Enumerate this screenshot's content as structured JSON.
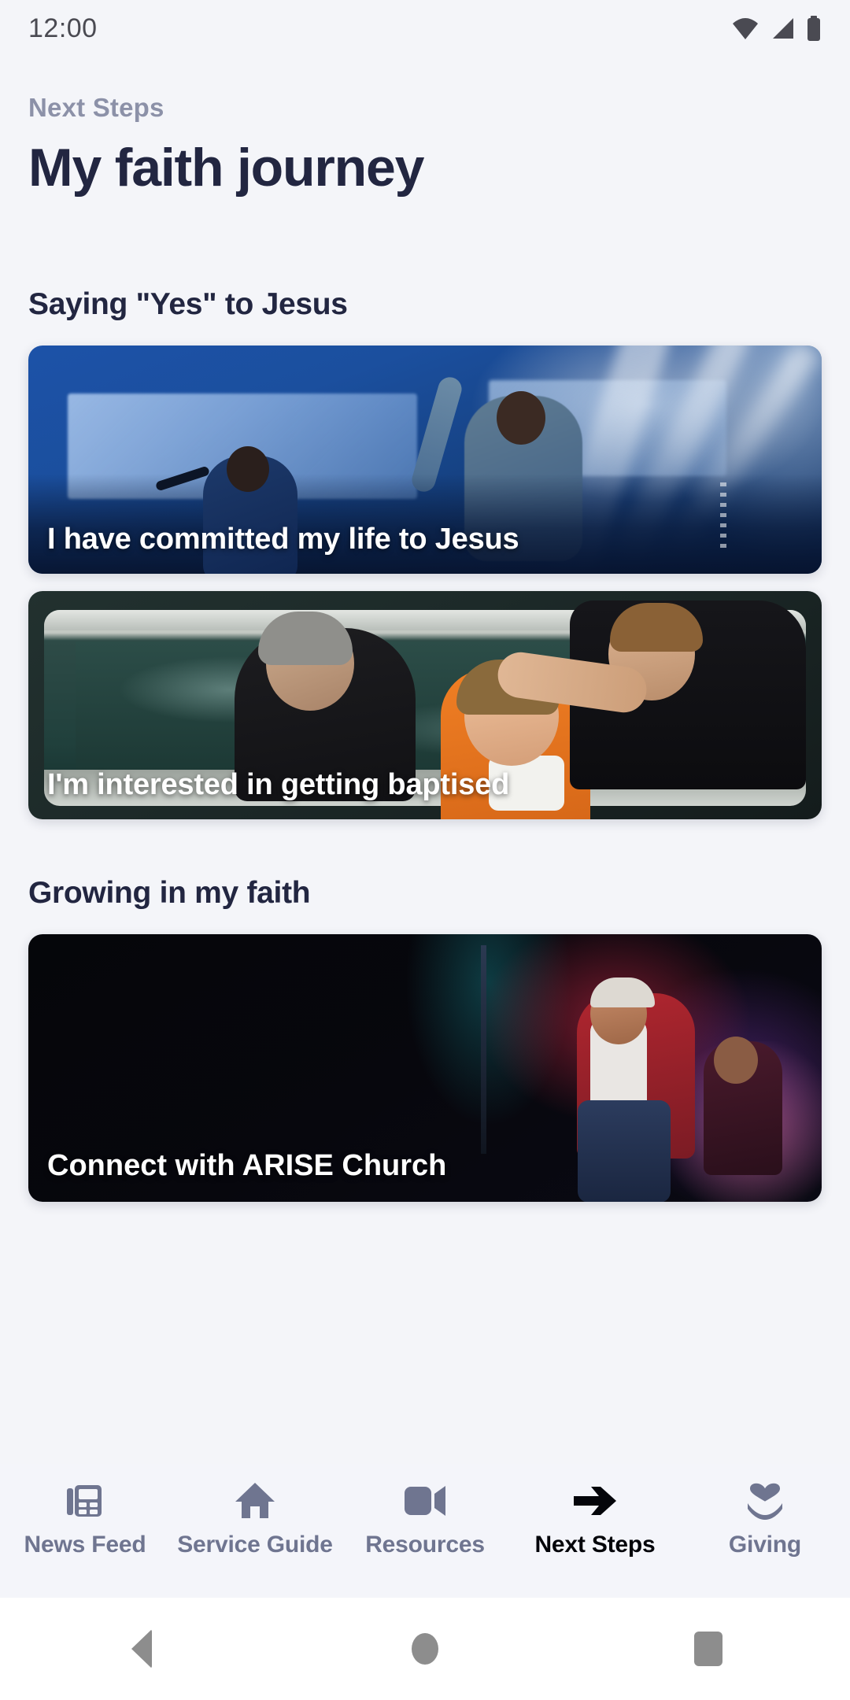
{
  "status_bar": {
    "time": "12:00",
    "icons": [
      "wifi-icon",
      "cellular-signal-icon",
      "battery-icon"
    ]
  },
  "header": {
    "eyebrow": "Next Steps",
    "title": "My faith journey"
  },
  "sections": [
    {
      "heading": "Saying \"Yes\" to Jesus",
      "cards": [
        {
          "caption": "I have committed my life to Jesus",
          "art": "worship-stage-photo"
        },
        {
          "caption": "I'm interested in getting baptised",
          "art": "baptism-photo"
        }
      ]
    },
    {
      "heading": "Growing in my faith",
      "cards": [
        {
          "caption": "Connect with ARISE Church",
          "art": "concert-stage-photo"
        }
      ]
    }
  ],
  "tab_bar": {
    "items": [
      {
        "label": "News Feed",
        "icon": "newspaper-icon",
        "active": false
      },
      {
        "label": "Service Guide",
        "icon": "home-icon",
        "active": false
      },
      {
        "label": "Resources",
        "icon": "video-camera-icon",
        "active": false
      },
      {
        "label": "Next Steps",
        "icon": "arrow-right-icon",
        "active": true
      },
      {
        "label": "Giving",
        "icon": "heart-hand-icon",
        "active": false
      }
    ]
  },
  "system_nav": {
    "buttons": [
      "back-button",
      "home-button",
      "recents-button"
    ]
  },
  "colors": {
    "background": "#f4f5f9",
    "title": "#222641",
    "eyebrow": "#8c91a8",
    "tab_inactive": "#6f7590",
    "tab_active": "#04050a"
  }
}
